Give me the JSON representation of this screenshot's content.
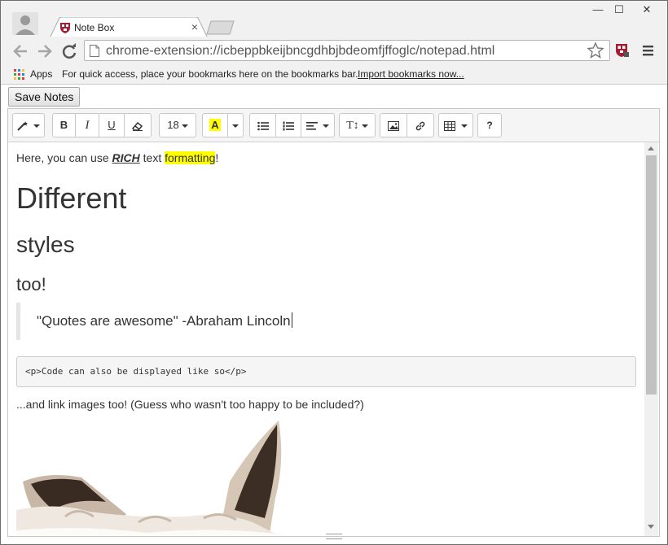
{
  "browser": {
    "tab_title": "Note Box",
    "tab_close": "×",
    "url": "chrome-extension://icbeppbkeijbncgdhbjbdeomfjffoglc/notepad.html",
    "window_controls": {
      "minimize": "—",
      "maximize": "☐",
      "close": "✕"
    }
  },
  "bookmarks_bar": {
    "apps_label": "Apps",
    "hint": "For quick access, place your bookmarks here on the bookmarks bar.",
    "import_link": "Import bookmarks now..."
  },
  "page": {
    "save_button": "Save Notes"
  },
  "editor_toolbar": {
    "font_size": "18",
    "highlight_letter": "A",
    "bold": "B",
    "italic": "I",
    "underline": "U",
    "text_height": "T↕",
    "help": "?",
    "highlight_color": "#ffff00"
  },
  "content": {
    "intro_before": "Here, you can use ",
    "intro_rich": "RICH",
    "intro_mid": " text ",
    "intro_formatting": "formatting",
    "intro_end": "!",
    "heading1": "Different",
    "heading2": "styles",
    "heading3": "too!",
    "quote": "\"Quotes are awesome\" -Abraham Lincoln",
    "code": "<p>Code can also be displayed like so</p>",
    "images_text": "...and link images too! (Guess who wasn't too happy to be included?)"
  },
  "icons": {
    "back": "back-arrow-icon",
    "forward": "forward-arrow-icon",
    "reload": "reload-icon",
    "star": "bookmark-star-icon",
    "menu": "hamburger-menu-icon"
  }
}
